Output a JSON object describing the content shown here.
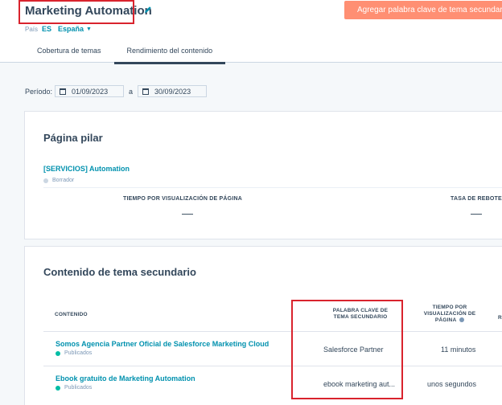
{
  "header": {
    "title": "Marketing Automation",
    "cta_label": "Agregar palabra clave de tema secundario",
    "country_label": "País",
    "country_code": "ES",
    "country_name": "España"
  },
  "tabs": [
    {
      "label": "Cobertura de temas",
      "active": false
    },
    {
      "label": "Rendimiento del contenido",
      "active": true
    }
  ],
  "period": {
    "label": "Período:",
    "start": "01/09/2023",
    "separator": "a",
    "end": "30/09/2023"
  },
  "pillar": {
    "title": "Página pilar",
    "link": "[SERVICIOS] Automation",
    "status": "Borrador",
    "metrics": [
      {
        "label": "TIEMPO POR VISUALIZACIÓN DE PÁGINA",
        "value": "—"
      },
      {
        "label": "TASA DE REBOTE",
        "value": "—"
      }
    ]
  },
  "subtopic": {
    "title": "Contenido de tema secundario",
    "columns": {
      "content": "CONTENIDO",
      "keyword": "PALABRA CLAVE DE TEMA SECUNDARIO",
      "time": "TIEMPO POR VISUALIZACIÓN DE PÁGINA",
      "extra": "R"
    },
    "rows": [
      {
        "title": "Somos Agencia Partner Oficial de Salesforce Marketing Cloud",
        "status": "Publicados",
        "keyword": "Salesforce Partner",
        "time": "11 minutos"
      },
      {
        "title": "Ebook gratuito de Marketing Automation",
        "status": "Publicados",
        "keyword": "ebook marketing aut...",
        "time": "unos segundos"
      }
    ]
  },
  "colors": {
    "accent": "#0091ae",
    "cta": "#ff8f73",
    "published": "#00bda5",
    "draft": "#cbd6e2",
    "highlight": "#d9232d"
  }
}
